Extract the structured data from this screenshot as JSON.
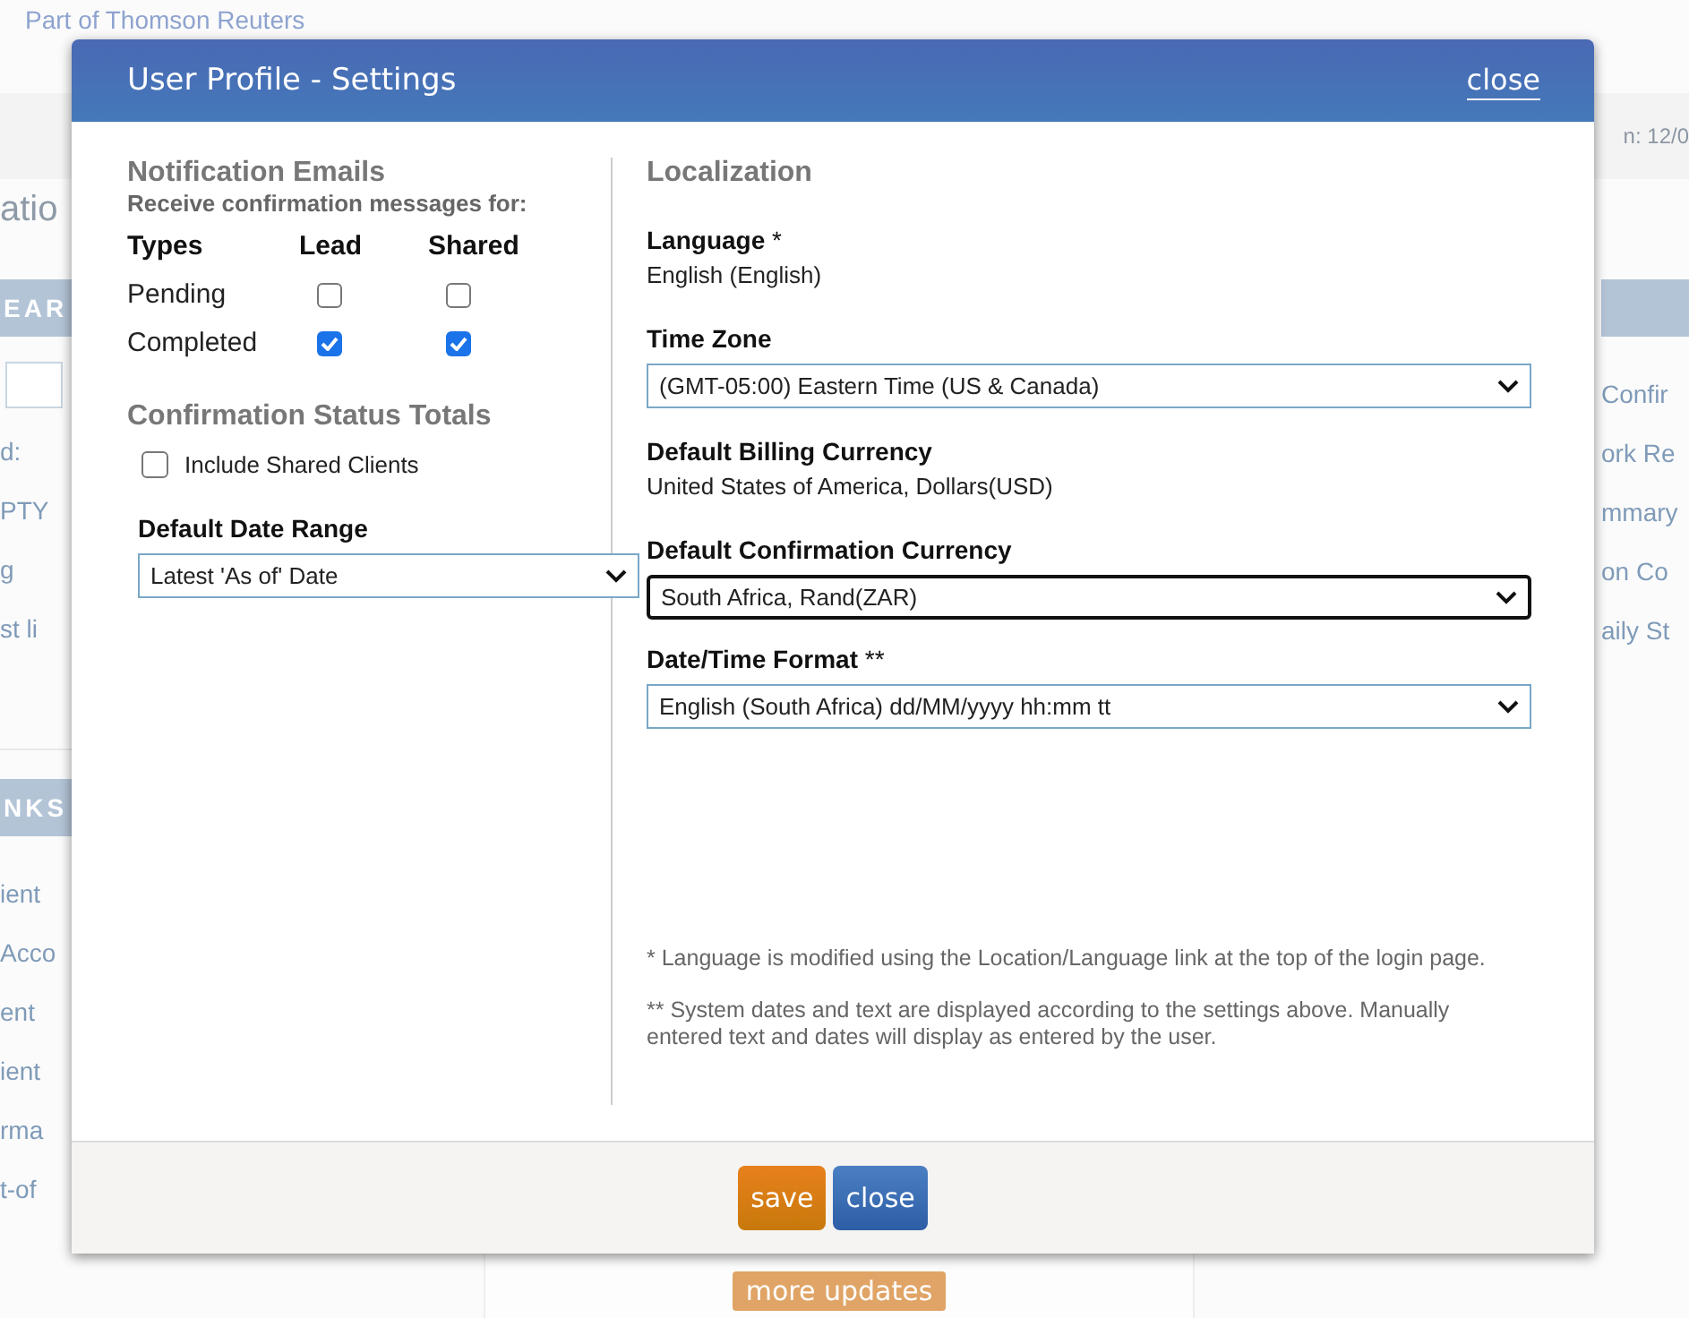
{
  "background": {
    "tagline": "Part of Thomson Reuters",
    "status": "n: 12/0",
    "heading": "atio",
    "left_panels": [
      {
        "kind": "search",
        "title": "EAR",
        "items": [
          "d:",
          "PTY",
          "g",
          "st li"
        ]
      },
      {
        "kind": "links",
        "title": "NKS",
        "items": [
          "ient",
          "Acco",
          "ent",
          "ient",
          "rma",
          "t-of"
        ]
      }
    ],
    "right_panel": {
      "items": [
        "Confir",
        "ork Re",
        "mmary",
        "on Co",
        "aily St"
      ]
    },
    "more_button": "more updates"
  },
  "dialog": {
    "title": "User Profile - Settings",
    "close_link": "close",
    "notifications": {
      "heading": "Notification Emails",
      "subheading": "Receive confirmation messages for:",
      "columns": [
        "Types",
        "Lead",
        "Shared"
      ],
      "rows": [
        {
          "type": "Pending",
          "lead": false,
          "shared": false
        },
        {
          "type": "Completed",
          "lead": true,
          "shared": true
        }
      ]
    },
    "totals": {
      "heading": "Confirmation Status Totals",
      "include_shared": {
        "label": "Include Shared Clients",
        "checked": false
      }
    },
    "date_range": {
      "label": "Default Date Range",
      "value": "Latest 'As of' Date"
    },
    "localization": {
      "heading": "Localization",
      "fields": [
        {
          "kind": "text",
          "label": "Language",
          "marker": "*",
          "value": "English (English)"
        },
        {
          "kind": "select",
          "label": "Time Zone",
          "value": "(GMT-05:00) Eastern Time (US & Canada)",
          "focused": false
        },
        {
          "kind": "text",
          "label": "Default Billing Currency",
          "value": "United States of America, Dollars(USD)"
        },
        {
          "kind": "select",
          "label": "Default Confirmation Currency",
          "value": "South Africa, Rand(ZAR)",
          "focused": true
        },
        {
          "kind": "select",
          "label": "Date/Time Format",
          "marker": "**",
          "value": "English (South Africa) dd/MM/yyyy hh:mm tt",
          "focused": false
        }
      ],
      "notes": [
        "* Language is modified using the Location/Language link at the top of the login page.",
        "** System dates and text are displayed according to the settings above. Manually entered text and dates will display as entered by the user."
      ]
    },
    "buttons": [
      {
        "kind": "save",
        "label": "save"
      },
      {
        "kind": "close",
        "label": "close"
      }
    ]
  }
}
